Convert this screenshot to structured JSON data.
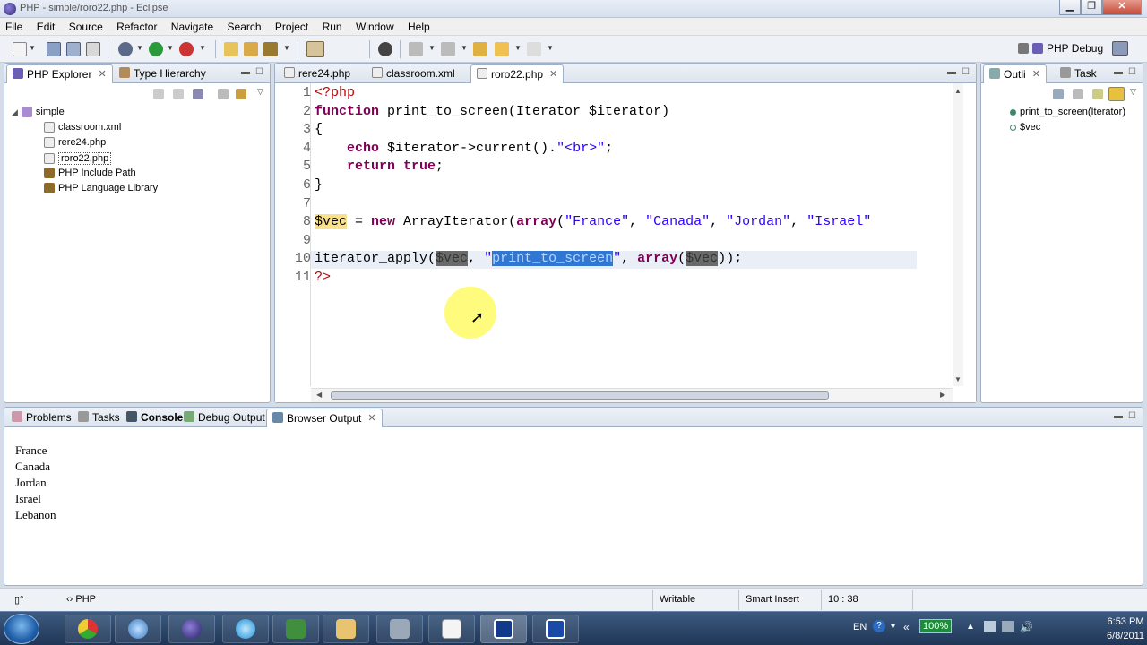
{
  "window": {
    "title": "PHP - simple/roro22.php - Eclipse",
    "min": "▁",
    "max": "❐",
    "close": "✕"
  },
  "menu": [
    "File",
    "Edit",
    "Source",
    "Refactor",
    "Navigate",
    "Search",
    "Project",
    "Run",
    "Window",
    "Help"
  ],
  "perspective": {
    "label": "PHP Debug"
  },
  "explorer": {
    "tabs": [
      {
        "label": "PHP Explorer"
      },
      {
        "label": "Type Hierarchy"
      }
    ],
    "project": "simple",
    "items": [
      "classroom.xml",
      "rere24.php",
      "roro22.php",
      "PHP Include Path",
      "PHP Language Library"
    ]
  },
  "editor": {
    "tabs": [
      {
        "label": "rere24.php"
      },
      {
        "label": "classroom.xml"
      },
      {
        "label": "roro22.php"
      }
    ],
    "lines": [
      {
        "n": "1",
        "html": "<span class='php'>&lt;?php</span>"
      },
      {
        "n": "2",
        "html": "<span class='kw'>function</span> print_to_screen(Iterator $iterator)"
      },
      {
        "n": "3",
        "html": "{"
      },
      {
        "n": "4",
        "html": "    <span class='kw'>echo</span> $iterator-&gt;current().<span class='str'>\"&lt;br&gt;\"</span>;"
      },
      {
        "n": "5",
        "html": "    <span class='kw'>return true</span>;"
      },
      {
        "n": "6",
        "html": "}"
      },
      {
        "n": "7",
        "html": ""
      },
      {
        "n": "8",
        "html": "<span class='var'>$vec</span> = <span class='kw'>new</span> ArrayIterator(<span class='kw'>array</span>(<span class='str'>\"France\"</span>, <span class='str'>\"Canada\"</span>, <span class='str'>\"Jordan\"</span>, <span class='str'>\"Israel\"</span>"
      },
      {
        "n": "9",
        "html": ""
      },
      {
        "n": "10",
        "html": "iterator_apply(<span class='occ'>$vec</span>, <span class='str'>\"<span class='sel'>print_to_screen</span>\"</span>, <span class='kw'>array</span>(<span class='occ'>$vec</span>));"
      },
      {
        "n": "11",
        "html": "<span class='php'>?&gt;</span>"
      }
    ]
  },
  "outline": {
    "tabs": [
      {
        "label": "Outli"
      },
      {
        "label": "Task"
      }
    ],
    "items": [
      "print_to_screen(Iterator)",
      "$vec"
    ]
  },
  "bottom": {
    "tabs": [
      "Problems",
      "Tasks",
      "Console",
      "Debug Output",
      "Browser Output"
    ],
    "output": [
      "France",
      "Canada",
      "Jordan",
      "Israel",
      "Lebanon"
    ]
  },
  "status": {
    "type": "PHP",
    "mode": "Writable",
    "insert": "Smart Insert",
    "position": "10 : 38"
  },
  "tray": {
    "lang": "EN",
    "battery": "100%",
    "time": "6:53 PM",
    "date": "6/8/2011"
  },
  "colors": {
    "keyword": "#7f0055",
    "string": "#2a00ff",
    "selection": "#2f77d0"
  }
}
